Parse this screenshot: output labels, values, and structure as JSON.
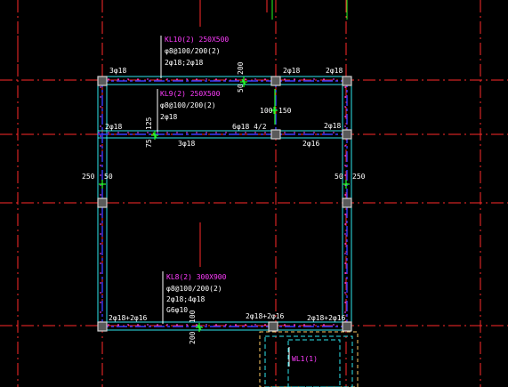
{
  "colors": {
    "background": "#000000",
    "axis_red": "#ff2a2a",
    "beam_blue": "#3c3cff",
    "beam_outline_cyan": "#2ee6ee",
    "beam_mid_magenta": "#ff3cff",
    "text_white": "#ffffff",
    "label_magenta": "#ff3cff",
    "dim_green": "#22ff22",
    "column_gray": "#b4b4b4"
  },
  "beam_labels": {
    "kl10": {
      "name": "KL10(2) 250X500",
      "stirrup": "φ8@100/200(2)",
      "bars": "2φ18;2φ18"
    },
    "kl9": {
      "name": "KL9(2) 250X500",
      "stirrup": "φ8@100/200(2)",
      "bars": "2φ18"
    },
    "kl8": {
      "name": "KL8(2) 300X900",
      "stirrup": "φ8@100/200(2)",
      "bars": "2φ18;4φ18",
      "side": "G6φ10"
    },
    "wl1": {
      "name": "WL1(1)"
    }
  },
  "rebar_texts": {
    "top_left": "3φ18",
    "top_mid": "2φ18",
    "top_right": "2φ18",
    "mid_left": "2φ18",
    "mid_under": "3φ18",
    "mid_six": "6φ18 4/2",
    "mid_right_top": "2φ18",
    "mid_right_under": "2φ16",
    "bottom_left": "2φ18+2φ16",
    "bottom_mid": "2φ18+2φ16",
    "bottom_right": "2φ18+2φ16"
  },
  "dimensions": {
    "dim_200_top": "200",
    "dim_50_top": "50",
    "dim_100": "100",
    "dim_150": "150",
    "dim_75": "75",
    "dim_125": "125",
    "dim_250_left": "250",
    "dim_50_left": "50",
    "dim_50_right": "50",
    "dim_250_right": "250",
    "dim_100_bottom": "100",
    "dim_200_bottom": "200"
  }
}
